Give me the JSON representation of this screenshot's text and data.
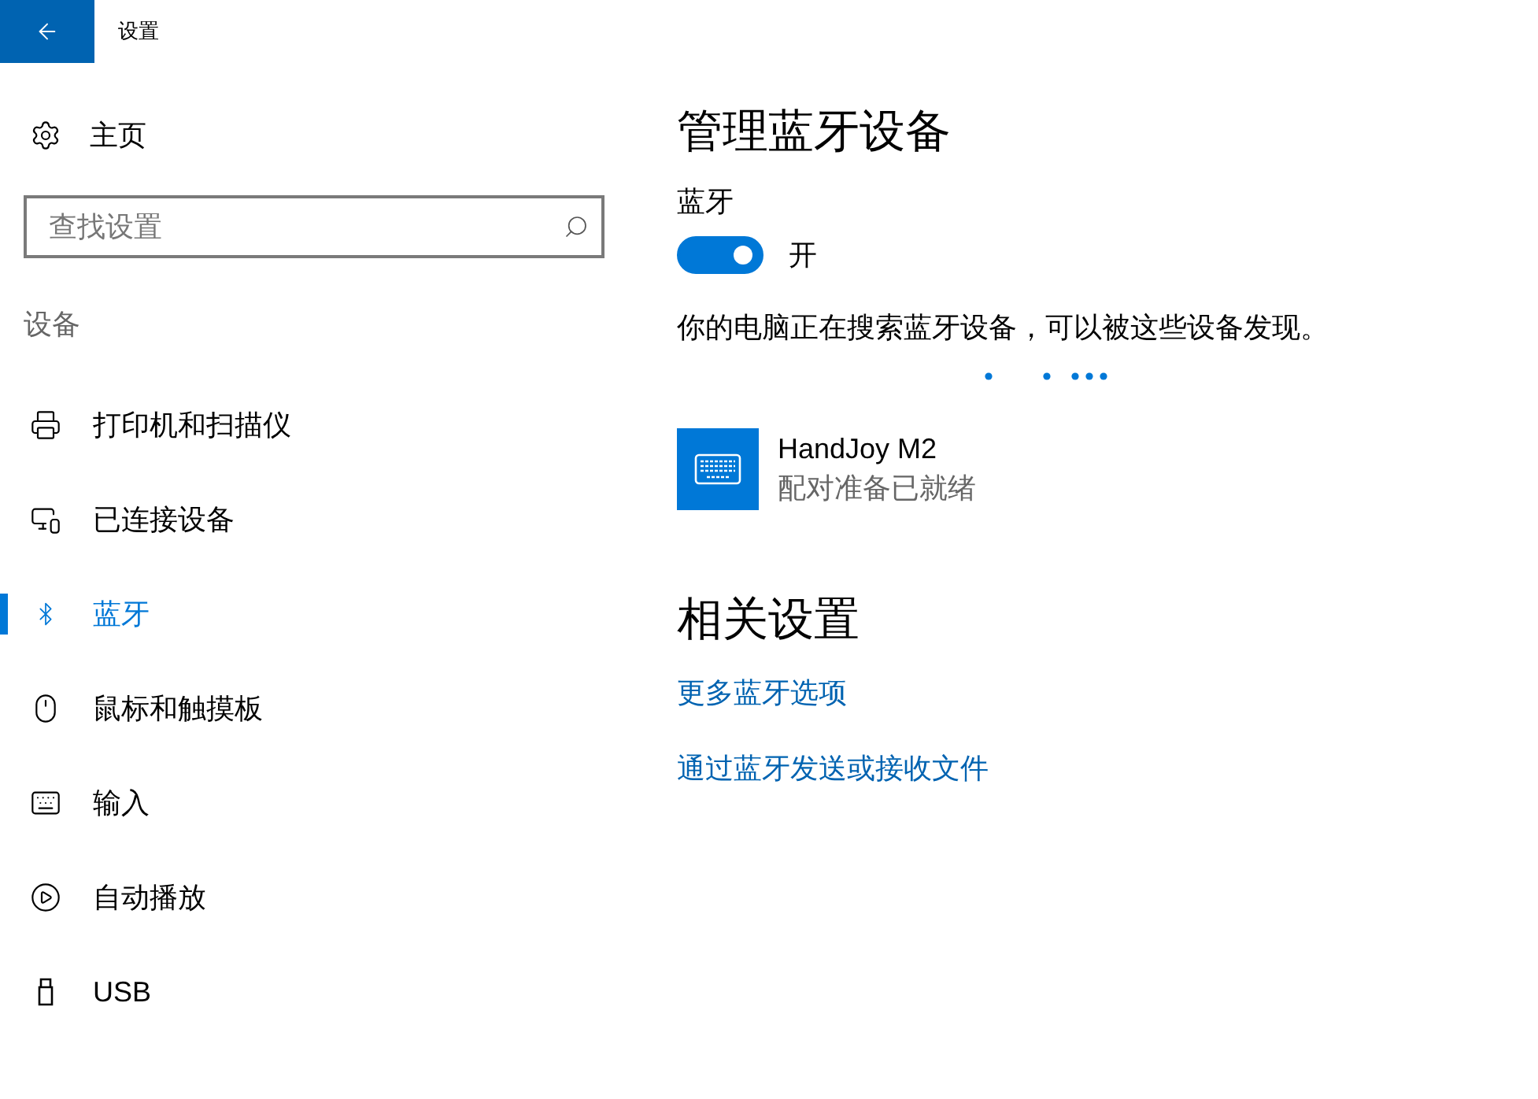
{
  "window": {
    "title": "设置"
  },
  "sidebar": {
    "home": "主页",
    "search": {
      "placeholder": "查找设置"
    },
    "section": "设备",
    "items": [
      {
        "label": "打印机和扫描仪",
        "kind": "printer",
        "selected": false
      },
      {
        "label": "已连接设备",
        "kind": "devices",
        "selected": false
      },
      {
        "label": "蓝牙",
        "kind": "bluetooth",
        "selected": true
      },
      {
        "label": "鼠标和触摸板",
        "kind": "mouse",
        "selected": false
      },
      {
        "label": "输入",
        "kind": "keyboard",
        "selected": false
      },
      {
        "label": "自动播放",
        "kind": "autoplay",
        "selected": false
      },
      {
        "label": "USB",
        "kind": "usb",
        "selected": false
      }
    ]
  },
  "main": {
    "title": "管理蓝牙设备",
    "bluetooth": {
      "label": "蓝牙",
      "on": true,
      "state": "开"
    },
    "status": "你的电脑正在搜索蓝牙设备，可以被这些设备发现。",
    "devices": [
      {
        "name": "HandJoy M2",
        "status": "配对准备已就绪"
      }
    ],
    "related_title": "相关设置",
    "links": [
      "更多蓝牙选项",
      "通过蓝牙发送或接收文件"
    ]
  }
}
